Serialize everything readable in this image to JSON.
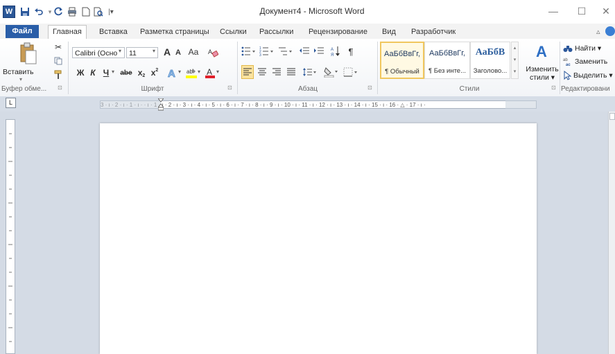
{
  "window": {
    "title": "Документ4 - Microsoft Word",
    "app_icon_letter": "W",
    "minimize": "—",
    "maximize": "☐",
    "close": "✕"
  },
  "quick_access": {
    "save_icon": "save-icon",
    "undo_icon": "undo-icon",
    "redo_icon": "redo-icon",
    "print_icon": "print-icon",
    "new_icon": "new-document-icon",
    "preview_icon": "print-preview-icon",
    "customize_icon": "customize-icon"
  },
  "tabs": [
    {
      "label": "Файл"
    },
    {
      "label": "Главная"
    },
    {
      "label": "Вставка"
    },
    {
      "label": "Разметка страницы"
    },
    {
      "label": "Ссылки"
    },
    {
      "label": "Рассылки"
    },
    {
      "label": "Рецензирование"
    },
    {
      "label": "Вид"
    },
    {
      "label": "Разработчик"
    }
  ],
  "ribbon": {
    "clipboard": {
      "paste_label": "Вставить",
      "group_label": "Буфер обме..."
    },
    "font": {
      "font_name": "Calibri (Осно",
      "font_size": "11",
      "grow": "A",
      "shrink": "A",
      "case": "Aa",
      "bold": "Ж",
      "italic": "К",
      "underline": "Ч",
      "strike": "abe",
      "subscript": "x",
      "superscript": "x",
      "group_label": "Шрифт"
    },
    "paragraph": {
      "group_label": "Абзац"
    },
    "styles": {
      "items": [
        {
          "sample": "АаБбВвГг,",
          "name": "¶ Обычный"
        },
        {
          "sample": "АаБбВвГг,",
          "name": "¶ Без инте..."
        },
        {
          "sample": "АаБбВ",
          "name": "Заголово..."
        }
      ],
      "change_styles_line1": "Изменить",
      "change_styles_line2": "стили ▾",
      "group_label": "Стили"
    },
    "editing": {
      "find": "Найти ▾",
      "replace": "Заменить",
      "select": "Выделить ▾",
      "group_label": "Редактировани"
    }
  },
  "ruler": {
    "text": "3 · ı · 2 · ı · 1 · ı ·   · ı · 1 · ı · 2 · ı · 3 · ı · 4 · ı · 5 · ı · 6 · ı · 7 · ı · 8 · ı · 9 · ı · 10 · ı · 11 · ı · 12 · ı · 13 · ı · 14 · ı · 15 · ı · 16 · △ · 17 · ı ·",
    "corner": "L"
  },
  "colors": {
    "accent": "#2b579a",
    "file_tab": "#2a5ea8",
    "workspace": "#d4dbe5"
  }
}
